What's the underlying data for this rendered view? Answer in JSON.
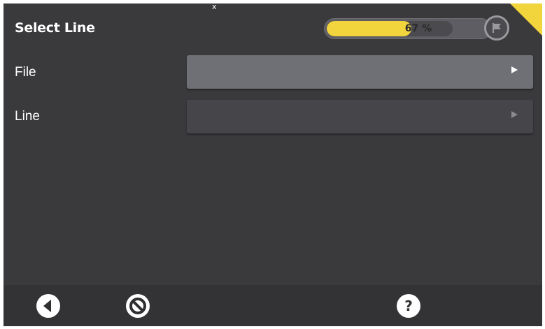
{
  "header": {
    "title": "Select Line",
    "progress": {
      "value_percent": 67,
      "label": "67 %"
    },
    "flag_icon": "flag-icon",
    "cursor": "x"
  },
  "rows": [
    {
      "label": "File",
      "state": "enabled"
    },
    {
      "label": "Line",
      "state": "disabled"
    }
  ],
  "footer": {
    "back_icon": "back-icon",
    "cancel_icon": "cancel-icon",
    "help_icon": "help-icon"
  },
  "colors": {
    "accent": "#f2d53c",
    "background": "#3a3a3d",
    "field_enabled": "#6f6f76",
    "field_disabled": "#45454a"
  }
}
